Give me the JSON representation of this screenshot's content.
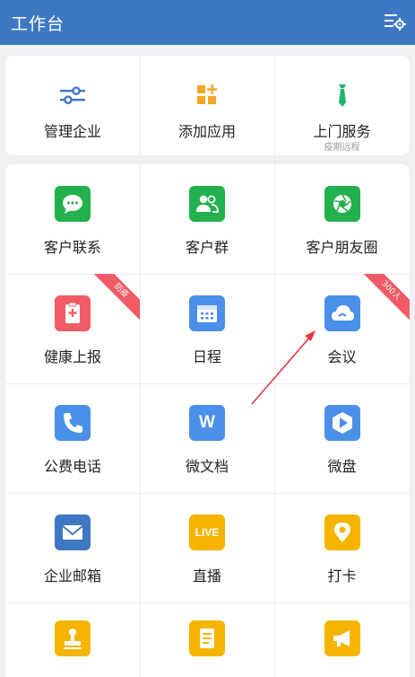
{
  "header": {
    "title": "工作台",
    "settings_icon": "list-settings-icon"
  },
  "top_row": [
    {
      "label": "管理企业",
      "icon": "sliders-icon",
      "color": "#3f78c2"
    },
    {
      "label": "添加应用",
      "icon": "add-app-icon",
      "color": "#f5a623"
    },
    {
      "label": "上门服务",
      "sublabel": "疫期远程",
      "icon": "tie-icon",
      "color": "#1fb46a"
    }
  ],
  "apps": [
    {
      "label": "客户联系",
      "icon": "chat-icon",
      "color": "#22b14c"
    },
    {
      "label": "客户群",
      "icon": "group-icon",
      "color": "#22b14c"
    },
    {
      "label": "客户朋友圈",
      "icon": "aperture-icon",
      "color": "#22b14c"
    },
    {
      "label": "健康上报",
      "icon": "health-clipboard-icon",
      "color": "#f05b66",
      "badge": "防疫"
    },
    {
      "label": "日程",
      "icon": "calendar-icon",
      "color": "#4a8fe8"
    },
    {
      "label": "会议",
      "icon": "cloud-icon",
      "color": "#4a8fe8",
      "badge": "300人"
    },
    {
      "label": "公费电话",
      "icon": "phone-icon",
      "color": "#4a8fe8"
    },
    {
      "label": "微文档",
      "icon": "doc-w-icon",
      "color": "#4a8fe8",
      "glyph": "W"
    },
    {
      "label": "微盘",
      "icon": "drive-icon",
      "color": "#4a8fe8"
    },
    {
      "label": "企业邮箱",
      "icon": "mail-icon",
      "color": "#3f78c2"
    },
    {
      "label": "直播",
      "icon": "live-icon",
      "color": "#f5b400",
      "glyph": "LIVE"
    },
    {
      "label": "打卡",
      "icon": "location-pin-icon",
      "color": "#f5b400"
    },
    {
      "label": "",
      "icon": "stamp-icon",
      "color": "#f5b400"
    },
    {
      "label": "",
      "icon": "form-icon",
      "color": "#f5b400"
    },
    {
      "label": "",
      "icon": "megaphone-icon",
      "color": "#f5b400"
    }
  ]
}
